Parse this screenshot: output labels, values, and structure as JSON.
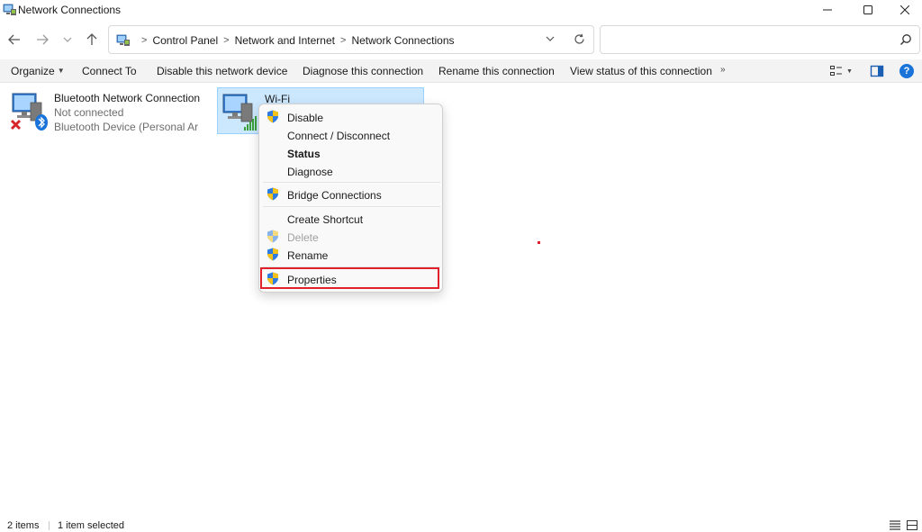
{
  "window": {
    "title": "Network Connections",
    "minimize_icon": "minimize-icon",
    "maximize_icon": "maximize-icon",
    "close_icon": "close-icon"
  },
  "nav": {
    "back_icon": "arrow-left-icon",
    "forward_icon": "arrow-right-icon",
    "recent_icon": "chevron-down-icon",
    "up_icon": "arrow-up-icon"
  },
  "address": {
    "breadcrumbs": [
      "Control Panel",
      "Network and Internet",
      "Network Connections"
    ],
    "separator": ">"
  },
  "search": {
    "value": "",
    "placeholder": ""
  },
  "toolbar": {
    "organize": "Organize",
    "connect_to": "Connect To",
    "disable_device": "Disable this network device",
    "diagnose": "Diagnose this connection",
    "rename": "Rename this connection",
    "view_status": "View status of this connection",
    "more": "»"
  },
  "items": [
    {
      "name": "Bluetooth Network Connection",
      "status": "Not connected",
      "device": "Bluetooth Device (Personal Area ...",
      "icon": "bluetooth-network-icon"
    },
    {
      "name": "Wi-Fi",
      "status": "",
      "device": "",
      "icon": "wifi-network-icon",
      "selected": true
    }
  ],
  "context_menu": {
    "items": [
      {
        "label": "Disable",
        "shield": true
      },
      {
        "label": "Connect / Disconnect",
        "shield": false
      },
      {
        "label": "Status",
        "shield": false,
        "bold": true
      },
      {
        "label": "Diagnose",
        "shield": false
      },
      {
        "label": "Bridge Connections",
        "shield": true
      },
      {
        "label": "Create Shortcut",
        "shield": false
      },
      {
        "label": "Delete",
        "shield": true,
        "disabled": true
      },
      {
        "label": "Rename",
        "shield": true
      },
      {
        "label": "Properties",
        "shield": true,
        "highlighted": true
      }
    ]
  },
  "statusbar": {
    "count": "2 items",
    "selected": "1 item selected"
  },
  "colors": {
    "selection_bg": "#cce8ff",
    "selection_border": "#99d1ff",
    "highlight_box": "#e0202a",
    "help_blue": "#1a73d9"
  }
}
